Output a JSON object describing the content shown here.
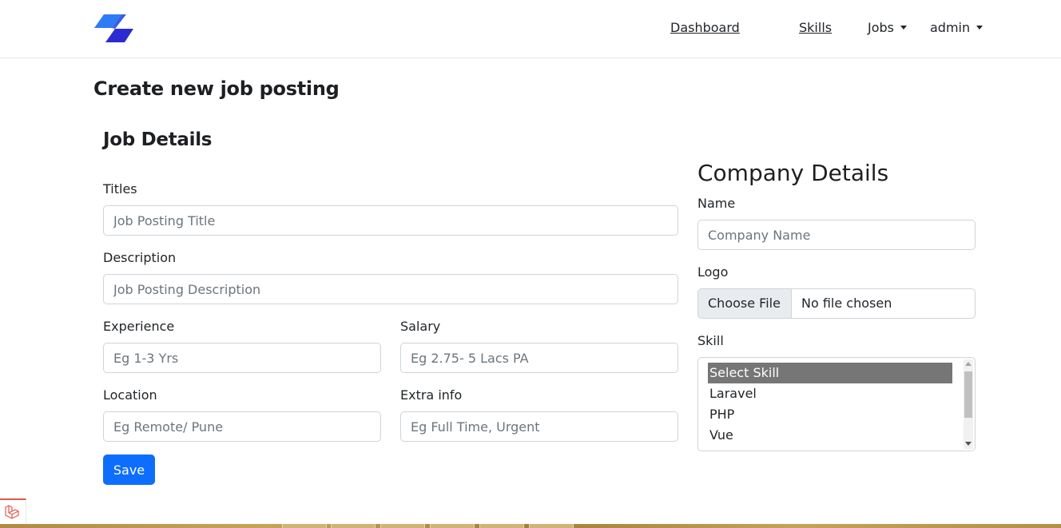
{
  "nav": {
    "logo_icon": "brand-logo-icon",
    "dashboard": "Dashboard",
    "skills": "Skills",
    "jobs": "Jobs",
    "admin": "admin"
  },
  "page": {
    "title": "Create new job posting"
  },
  "job": {
    "section_title": "Job Details",
    "titles_label": "Titles",
    "titles_placeholder": "Job Posting Title",
    "titles_value": "",
    "description_label": "Description",
    "description_placeholder": "Job Posting Description",
    "description_value": "",
    "experience_label": "Experience",
    "experience_placeholder": "Eg 1-3 Yrs",
    "experience_value": "",
    "salary_label": "Salary",
    "salary_placeholder": "Eg 2.75- 5 Lacs PA",
    "salary_value": "",
    "location_label": "Location",
    "location_placeholder": "Eg Remote/ Pune",
    "location_value": "",
    "extra_label": "Extra info",
    "extra_placeholder": "Eg Full Time, Urgent",
    "extra_value": "",
    "save_label": "Save"
  },
  "company": {
    "section_title": "Company Details",
    "name_label": "Name",
    "name_placeholder": "Company Name",
    "name_value": "",
    "logo_label": "Logo",
    "choose_file": "Choose File",
    "no_file": "No file chosen",
    "skill_label": "Skill",
    "skill_options": [
      "Select Skill",
      "Laravel",
      "PHP",
      "Vue"
    ],
    "skill_selected": "Select Skill"
  },
  "colors": {
    "primary": "#0d6efd",
    "logo_light": "#2f7bf5",
    "logo_dark": "#2b2bd1",
    "laravel_red": "#e05a4b"
  }
}
